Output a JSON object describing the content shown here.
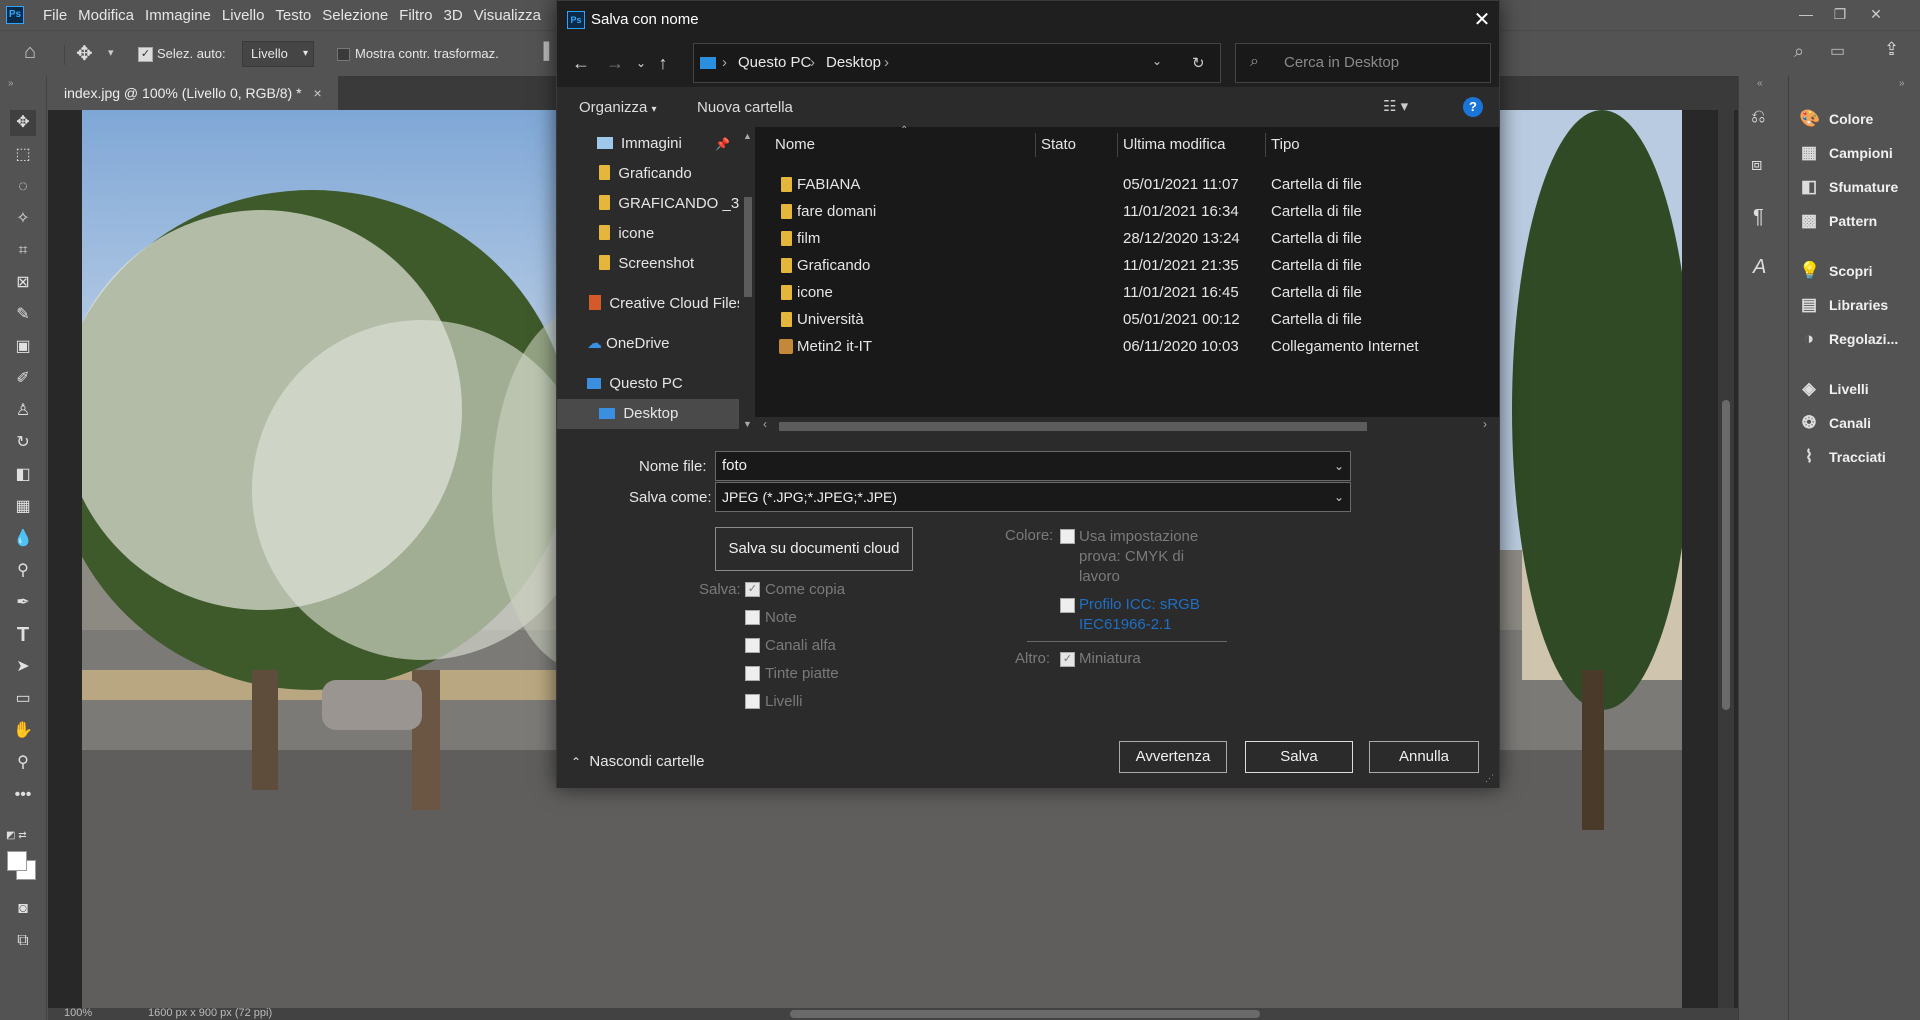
{
  "app": {
    "menu": [
      "File",
      "Modifica",
      "Immagine",
      "Livello",
      "Testo",
      "Selezione",
      "Filtro",
      "3D",
      "Visualizza"
    ],
    "options": {
      "auto_select_label": "Selez. auto:",
      "auto_select_value": "Livello",
      "show_transform_label": "Mostra contr. trasformaz."
    },
    "doc_tab": "index.jpg @ 100% (Livello 0, RGB/8) *",
    "status": {
      "zoom": "100%",
      "size": "1600 px x 900 px (72 ppi)"
    },
    "panels": [
      {
        "label": "Colore",
        "icon": "palette-icon"
      },
      {
        "label": "Campioni",
        "icon": "grid-icon"
      },
      {
        "label": "Sfumature",
        "icon": "gradient-icon"
      },
      {
        "label": "Pattern",
        "icon": "pattern-icon"
      },
      {
        "label": "Scopri",
        "icon": "lightbulb-icon"
      },
      {
        "label": "Libraries",
        "icon": "libraries-icon"
      },
      {
        "label": "Regolazi...",
        "icon": "adjust-icon"
      },
      {
        "label": "Livelli",
        "icon": "layers-icon"
      },
      {
        "label": "Canali",
        "icon": "channels-icon"
      },
      {
        "label": "Tracciati",
        "icon": "paths-icon"
      }
    ]
  },
  "dialog": {
    "title": "Salva con nome",
    "breadcrumb": [
      "Questo PC",
      "Desktop"
    ],
    "search_placeholder": "Cerca in Desktop",
    "organize": "Organizza",
    "new_folder": "Nuova cartella",
    "tree": [
      "Immagini",
      "Graficando",
      "GRAFICANDO _3",
      "icone",
      "Screenshot",
      "Creative Cloud Files",
      "OneDrive",
      "Questo PC",
      "Desktop"
    ],
    "columns": [
      "Nome",
      "Stato",
      "Ultima modifica",
      "Tipo"
    ],
    "files": [
      {
        "name": "FABIANA",
        "date": "05/01/2021 11:07",
        "type": "Cartella di file"
      },
      {
        "name": "fare domani",
        "date": "11/01/2021 16:34",
        "type": "Cartella di file"
      },
      {
        "name": "film",
        "date": "28/12/2020 13:24",
        "type": "Cartella di file"
      },
      {
        "name": "Graficando",
        "date": "11/01/2021 21:35",
        "type": "Cartella di file"
      },
      {
        "name": "icone",
        "date": "11/01/2021 16:45",
        "type": "Cartella di file"
      },
      {
        "name": "Università",
        "date": "05/01/2021 00:12",
        "type": "Cartella di file"
      },
      {
        "name": "Metin2 it-IT",
        "date": "06/11/2020 10:03",
        "type": "Collegamento Internet"
      }
    ],
    "filename_label": "Nome file:",
    "filename_value": "foto",
    "savetype_label": "Salva come:",
    "savetype_value": "JPEG (*.JPG;*.JPEG;*.JPE)",
    "cloud_button": "Salva su documenti cloud",
    "save_label": "Salva:",
    "save_options": [
      {
        "label": "Come copia",
        "checked": true
      },
      {
        "label": "Note",
        "checked": false
      },
      {
        "label": "Canali alfa",
        "checked": false
      },
      {
        "label": "Tinte piatte",
        "checked": false
      },
      {
        "label": "Livelli",
        "checked": false
      }
    ],
    "color_label": "Colore:",
    "proof_line1": "Usa impostazione",
    "proof_line2": "prova:  CMYK di",
    "proof_line3": "lavoro",
    "icc_line1": "Profilo ICC:  sRGB",
    "icc_line2": "IEC61966-2.1",
    "other_label": "Altro:",
    "thumbnail": "Miniatura",
    "hide_folders": "Nascondi cartelle",
    "warning": "Avvertenza",
    "save": "Salva",
    "cancel": "Annulla"
  }
}
